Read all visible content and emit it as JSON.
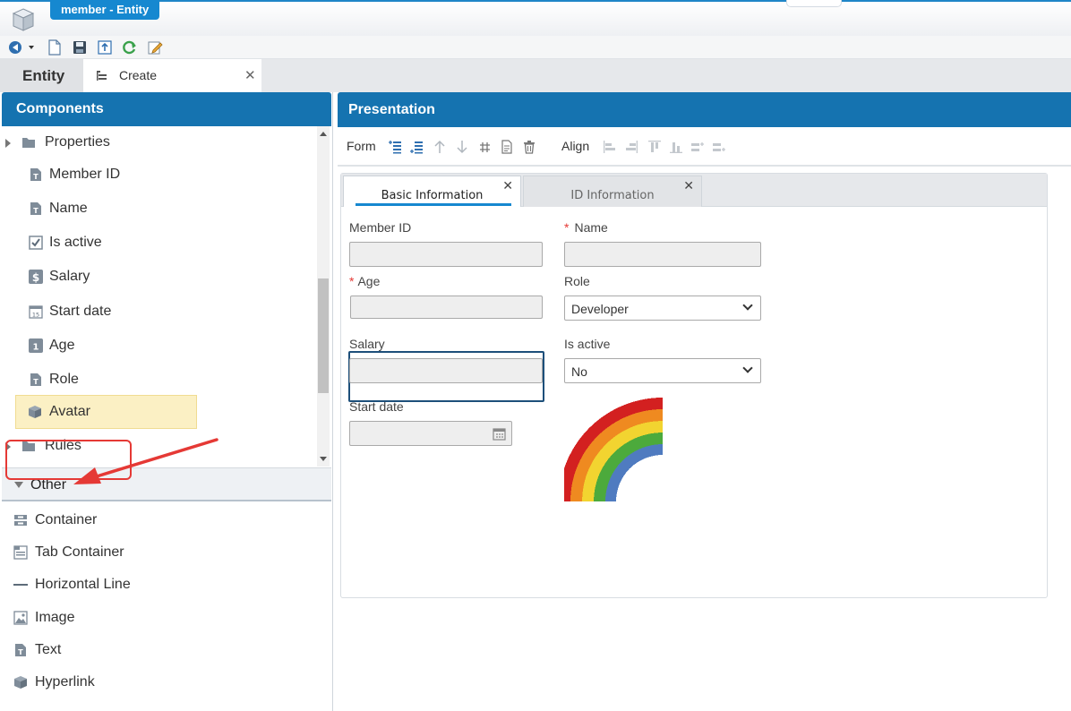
{
  "window": {
    "title": "member - Entity"
  },
  "tabs": [
    {
      "label": "Entity"
    },
    {
      "label": "Create"
    }
  ],
  "components": {
    "title": "Components",
    "tree": [
      {
        "label": "Properties",
        "type": "folder"
      },
      {
        "label": "Member ID",
        "type": "text-field"
      },
      {
        "label": "Name",
        "type": "text-field"
      },
      {
        "label": "Is active",
        "type": "checkbox"
      },
      {
        "label": "Salary",
        "type": "currency"
      },
      {
        "label": "Start date",
        "type": "date"
      },
      {
        "label": "Age",
        "type": "number"
      },
      {
        "label": "Role",
        "type": "text-field"
      },
      {
        "label": "Avatar",
        "type": "cube",
        "selected": true
      },
      {
        "label": "Rules",
        "type": "folder"
      }
    ],
    "other": {
      "label": "Other",
      "items": [
        {
          "label": "Container"
        },
        {
          "label": "Tab Container"
        },
        {
          "label": "Horizontal Line"
        },
        {
          "label": "Image"
        },
        {
          "label": "Text"
        },
        {
          "label": "Hyperlink"
        }
      ]
    }
  },
  "presentation": {
    "title": "Presentation",
    "toolbar": {
      "form_label": "Form",
      "align_label": "Align"
    },
    "tabs": [
      {
        "label": "Basic Information",
        "active": true
      },
      {
        "label": "ID Information",
        "active": false
      }
    ],
    "fields": {
      "member_id": {
        "label": "Member ID",
        "value": ""
      },
      "name": {
        "label": "Name",
        "required": true,
        "value": ""
      },
      "age": {
        "label": "Age",
        "required": true,
        "value": ""
      },
      "role": {
        "label": "Role",
        "value": "Developer"
      },
      "salary": {
        "label": "Salary",
        "value": ""
      },
      "is_active": {
        "label": "Is active",
        "value": "No"
      },
      "start_date": {
        "label": "Start date",
        "value": ""
      }
    }
  },
  "colors": {
    "header_blue": "#1573b0",
    "title_pill": "#1688d0",
    "selected_row": "#fbf0c4",
    "required_star": "#e53935",
    "callout_red": "#e53935"
  }
}
